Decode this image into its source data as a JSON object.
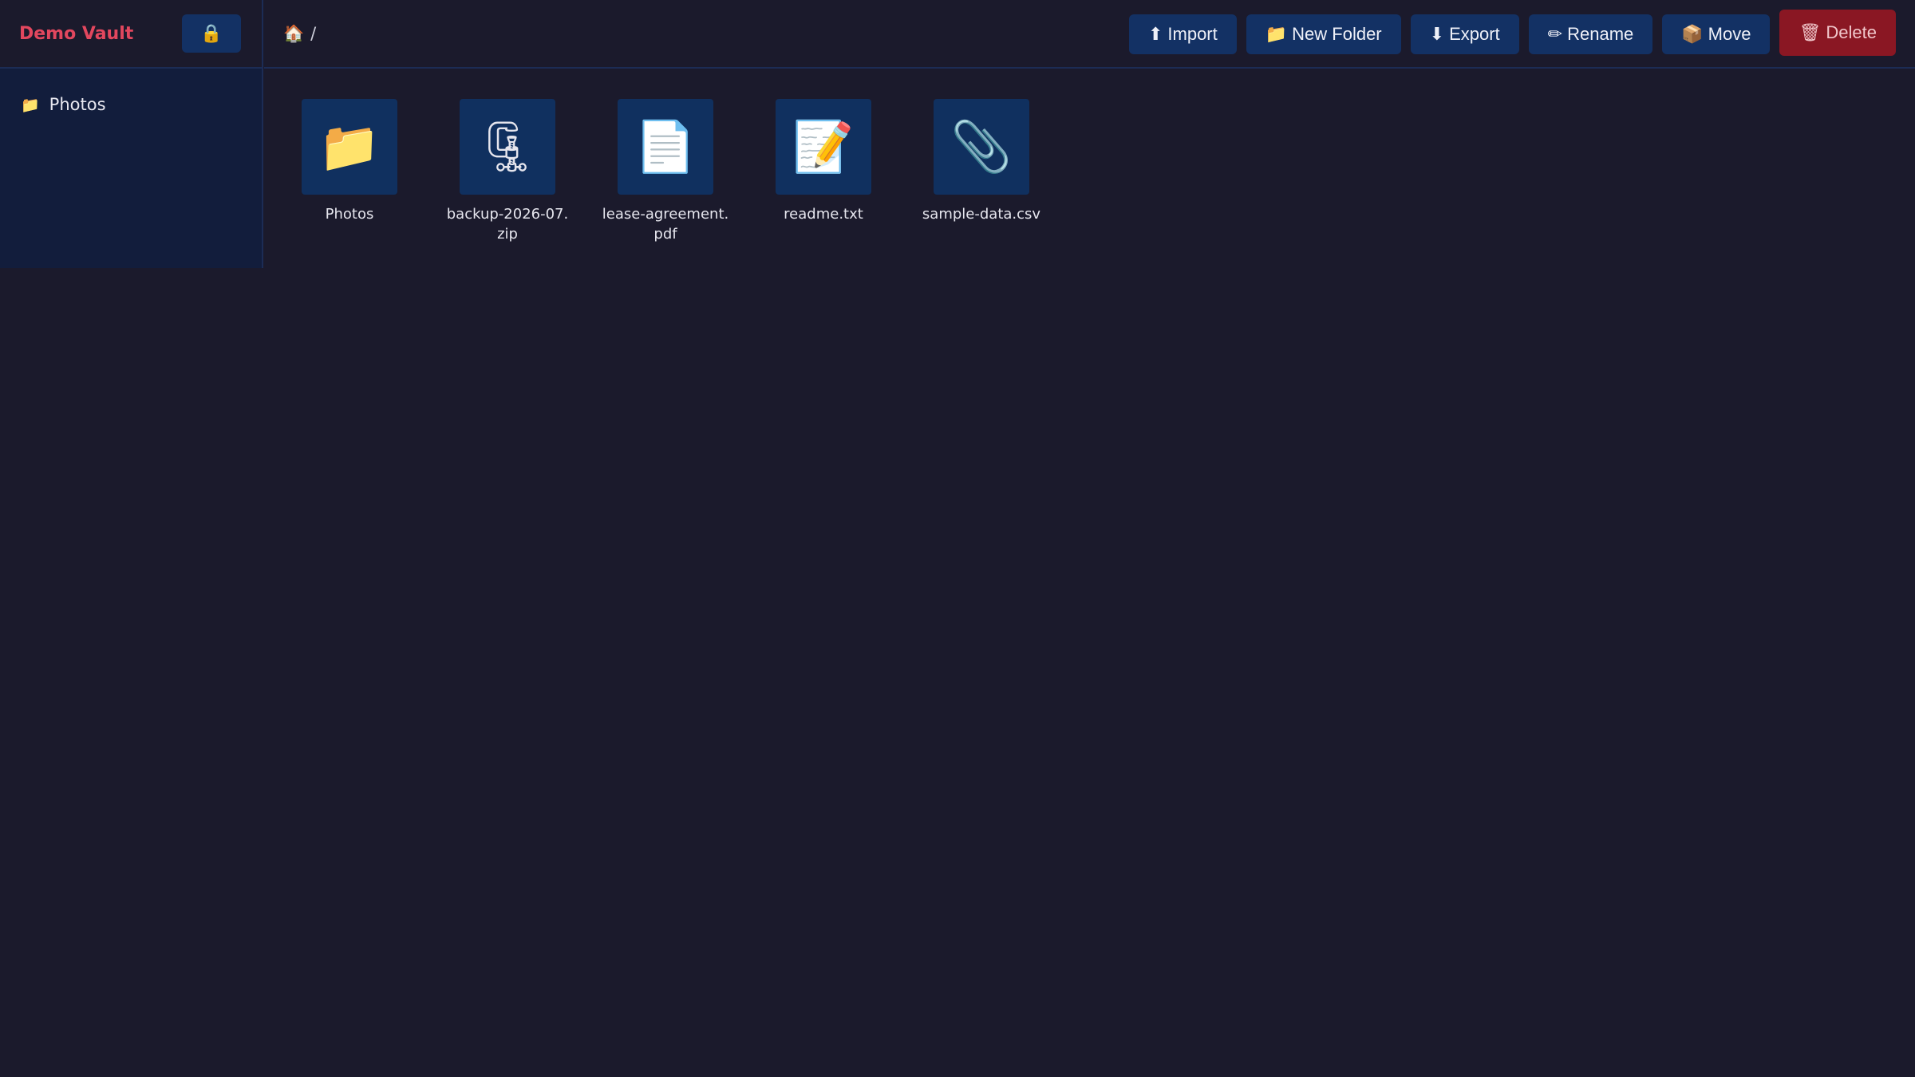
{
  "sidebar": {
    "title": "Demo Vault",
    "lock_icon": "🔒",
    "tree": [
      {
        "icon": "📁",
        "label": "Photos"
      }
    ]
  },
  "topbar": {
    "breadcrumb": {
      "home_icon": "🏠",
      "separator": "/"
    },
    "buttons": [
      {
        "name": "import-button",
        "icon": "⬆",
        "label": "Import"
      },
      {
        "name": "new-folder-button",
        "icon": "📁",
        "label": "New Folder"
      },
      {
        "name": "export-button",
        "icon": "⬇",
        "label": "Export"
      },
      {
        "name": "rename-button",
        "icon": "✏",
        "label": "Rename"
      },
      {
        "name": "move-button",
        "icon": "📦",
        "label": "Move"
      },
      {
        "name": "delete-button",
        "icon": "🗑",
        "label": "Delete"
      }
    ]
  },
  "files": [
    {
      "icon": "📁",
      "name": "Photos"
    },
    {
      "icon": "🗜",
      "name": "backup-2026-07.zip"
    },
    {
      "icon": "📄",
      "name": "lease-agreement.pdf"
    },
    {
      "icon": "📝",
      "name": "readme.txt"
    },
    {
      "icon": "📎",
      "name": "sample-data.csv"
    }
  ],
  "colors": {
    "background": "#1b1a2c",
    "sidebar": "#121d3c",
    "button": "#133164",
    "danger": "#8a1723",
    "brand": "#e2475e"
  }
}
